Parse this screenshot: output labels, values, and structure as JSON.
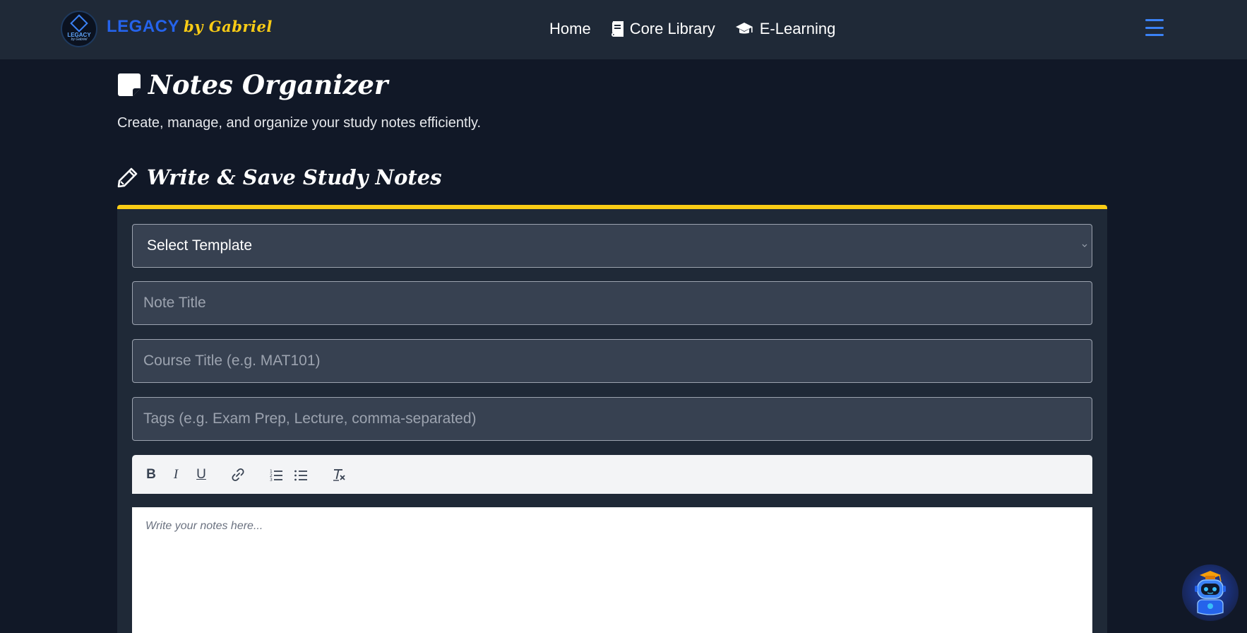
{
  "navbar": {
    "logo_text": "LEGACY",
    "logo_sub": "by Gabriel",
    "brand_name": "LEGACY",
    "brand_by": "by Gabriel",
    "links": [
      {
        "label": "Home",
        "icon": "none"
      },
      {
        "label": "Core Library",
        "icon": "book-icon"
      },
      {
        "label": "E-Learning",
        "icon": "graduation-cap-icon"
      }
    ],
    "menu_icon": "hamburger-menu-icon"
  },
  "page": {
    "title": "Notes Organizer",
    "subtitle": "Create, manage, and organize your study notes efficiently."
  },
  "section": {
    "title": "Write & Save Study Notes"
  },
  "form": {
    "template_select": "Select Template",
    "title_placeholder": "Note Title",
    "course_placeholder": "Course Title (e.g. MAT101)",
    "tags_placeholder": "Tags (e.g. Exam Prep, Lecture, comma-separated)"
  },
  "toolbar": {
    "bold": "B",
    "italic": "I",
    "underline": "U"
  },
  "editor": {
    "placeholder": "Write your notes here..."
  },
  "colors": {
    "page_bg": "#111827",
    "navbar_bg": "#1f2937",
    "brand_blue": "#2563eb",
    "accent_yellow": "#facc15",
    "field_bg": "#374151"
  }
}
